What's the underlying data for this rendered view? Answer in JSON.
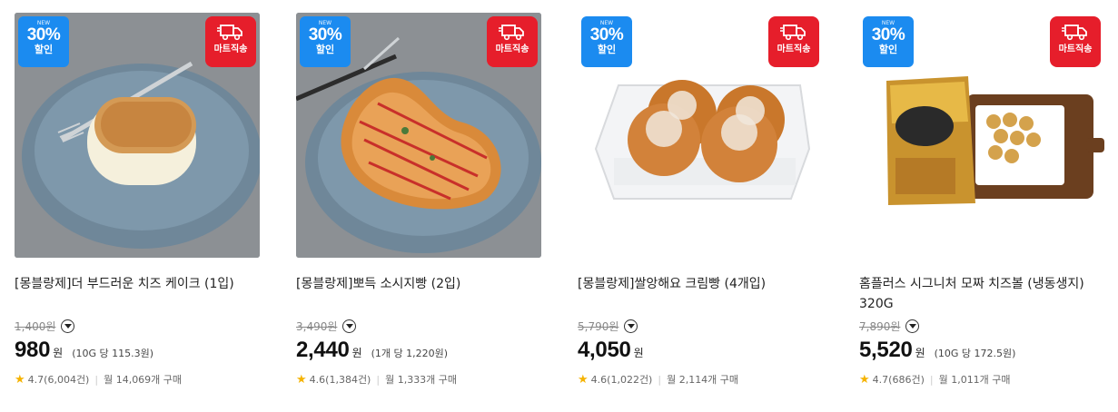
{
  "badge": {
    "sale_tiny": "NEW",
    "sale_pct": "30%",
    "sale_label": "할인",
    "ship_label": "마트직송"
  },
  "currency": "원",
  "colors": {
    "sale": "#1b8bf0",
    "ship": "#e61e2b",
    "star": "#f5b301"
  },
  "products": [
    {
      "title": "[몽블랑제]더 부드러운 치즈 케이크 (1입)",
      "orig": "1,400원",
      "price": "980",
      "unit": "(10G 당 115.3원)",
      "rating": "4.7",
      "reviews": "(6,004건)",
      "sold": "월 14,069개 구매"
    },
    {
      "title": "[몽블랑제]뽀득 소시지빵 (2입)",
      "orig": "3,490원",
      "price": "2,440",
      "unit": "(1개 당 1,220원)",
      "rating": "4.6",
      "reviews": "(1,384건)",
      "sold": "월 1,333개 구매"
    },
    {
      "title": "[몽블랑제]쌀앙해요 크림빵 (4개입)",
      "orig": "5,790원",
      "price": "4,050",
      "unit": "",
      "rating": "4.6",
      "reviews": "(1,022건)",
      "sold": "월 2,114개 구매"
    },
    {
      "title": "홈플러스 시그니처 모짜 치즈볼 (냉동생지) 320G",
      "orig": "7,890원",
      "price": "5,520",
      "unit": "(10G 당 172.5원)",
      "rating": "4.7",
      "reviews": "(686건)",
      "sold": "월 1,011개 구매"
    }
  ]
}
